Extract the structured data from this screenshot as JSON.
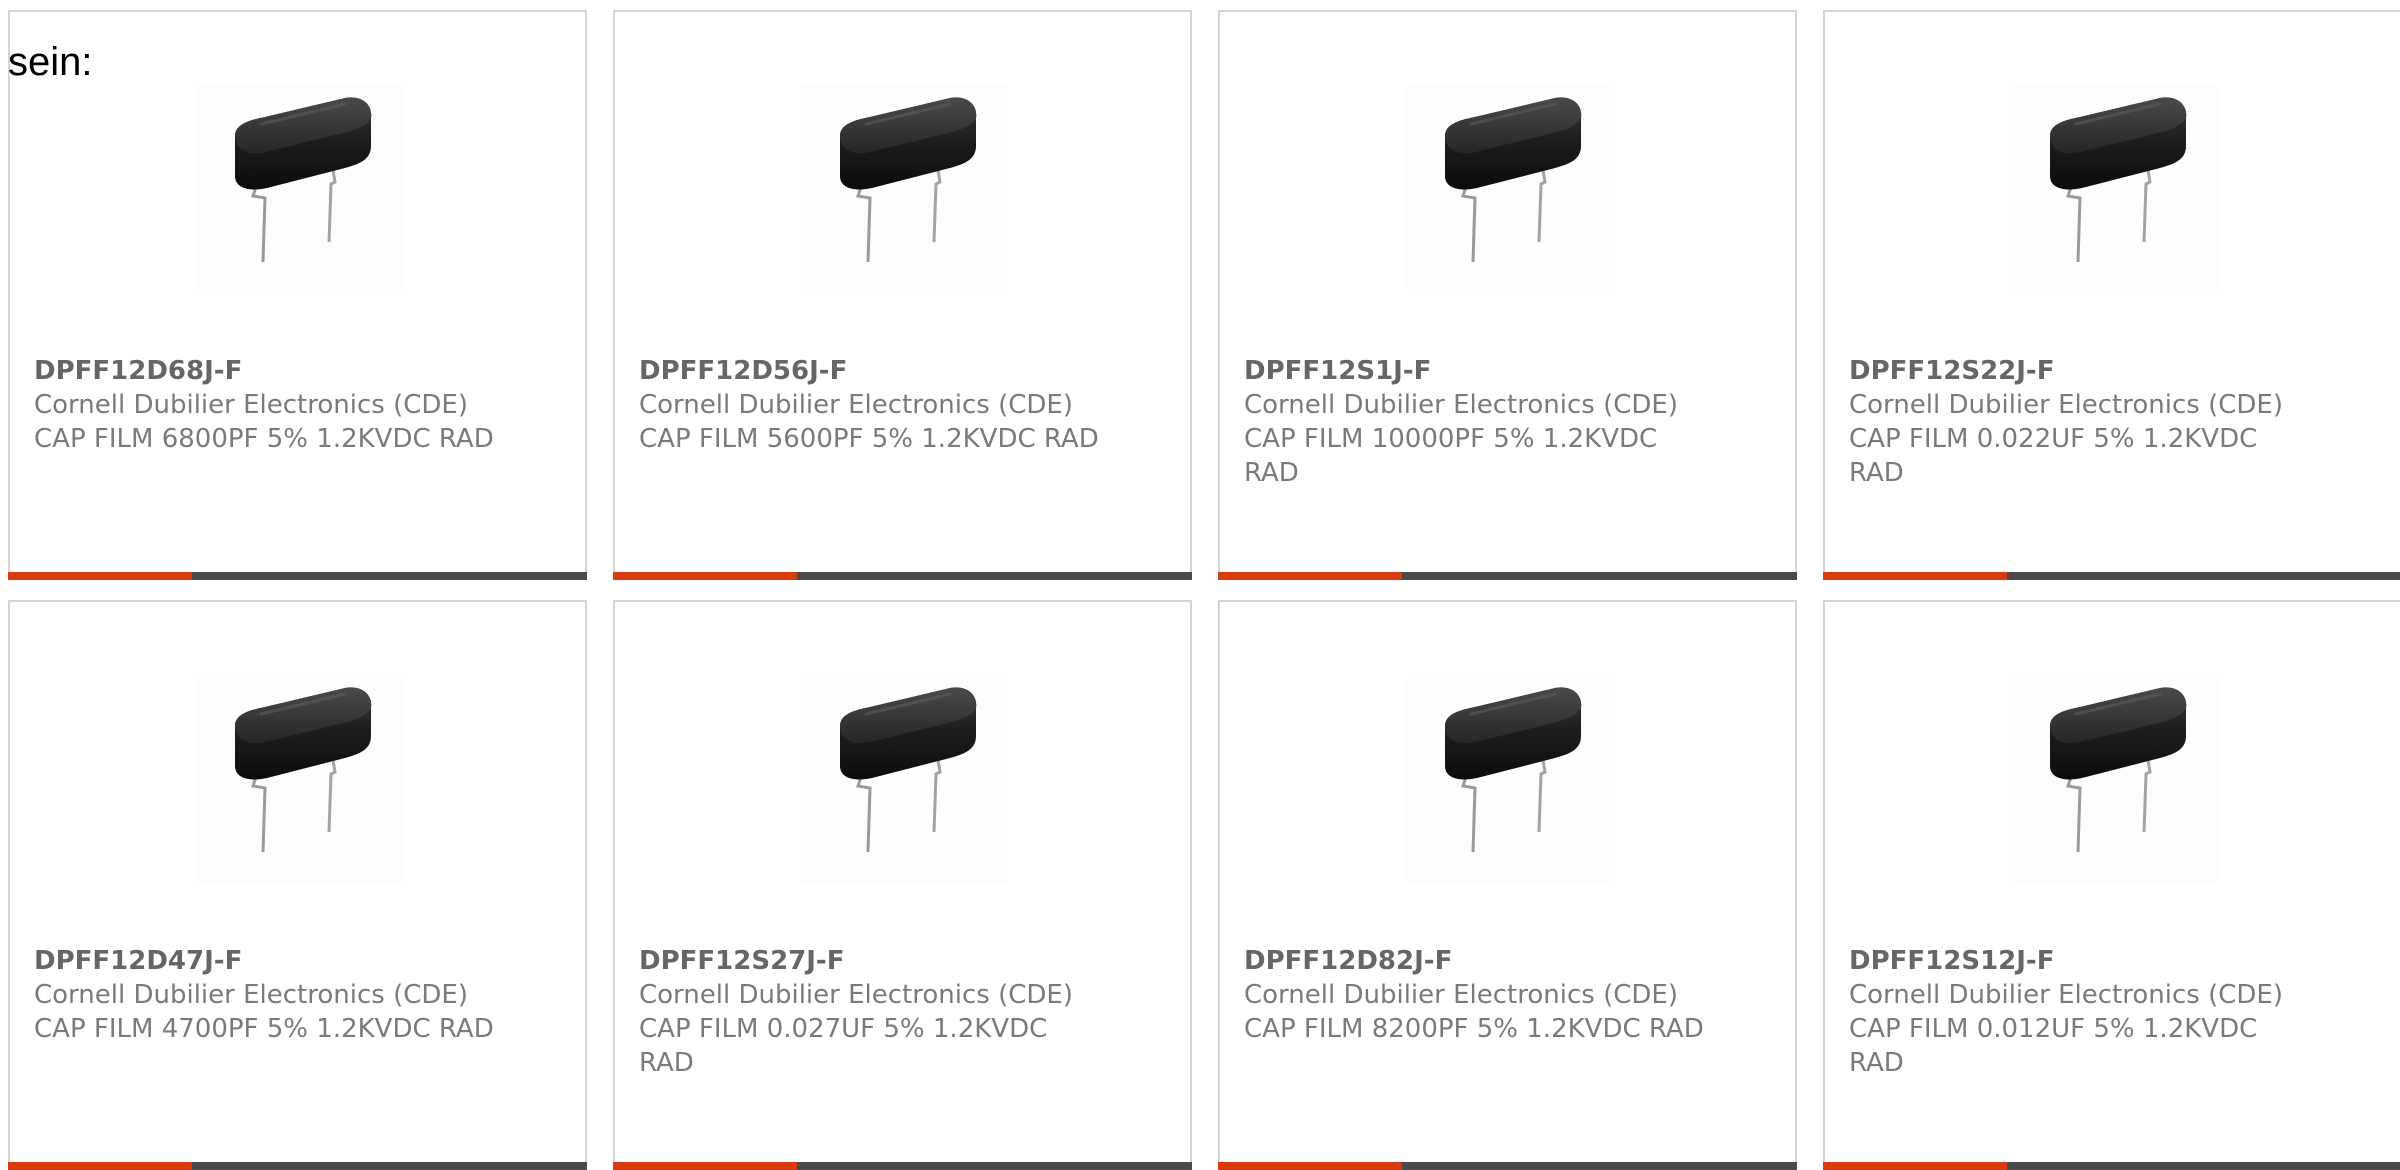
{
  "intro_text": "sein:",
  "colors": {
    "card_border": "#d4d4d4",
    "bar_dark": "#4a4a4a",
    "bar_accent": "#d93a0e",
    "text_gray": "#7a7a7a"
  },
  "products": [
    {
      "part_number": "DPFF12D68J-F",
      "manufacturer": "Cornell Dubilier Electronics (CDE)",
      "description": "CAP FILM 6800PF 5% 1.2KVDC RAD",
      "image": "film-capacitor-photo"
    },
    {
      "part_number": "DPFF12D56J-F",
      "manufacturer": "Cornell Dubilier Electronics (CDE)",
      "description": "CAP FILM 5600PF 5% 1.2KVDC RAD",
      "image": "film-capacitor-photo"
    },
    {
      "part_number": "DPFF12S1J-F",
      "manufacturer": "Cornell Dubilier Electronics (CDE)",
      "description": "CAP FILM 10000PF 5% 1.2KVDC RAD",
      "image": "film-capacitor-photo"
    },
    {
      "part_number": "DPFF12S22J-F",
      "manufacturer": "Cornell Dubilier Electronics (CDE)",
      "description": "CAP FILM 0.022UF 5% 1.2KVDC RAD",
      "image": "film-capacitor-photo"
    },
    {
      "part_number": "DPFF12D47J-F",
      "manufacturer": "Cornell Dubilier Electronics (CDE)",
      "description": "CAP FILM 4700PF 5% 1.2KVDC RAD",
      "image": "film-capacitor-photo"
    },
    {
      "part_number": "DPFF12S27J-F",
      "manufacturer": "Cornell Dubilier Electronics (CDE)",
      "description": "CAP FILM 0.027UF 5% 1.2KVDC RAD",
      "image": "film-capacitor-photo"
    },
    {
      "part_number": "DPFF12D82J-F",
      "manufacturer": "Cornell Dubilier Electronics (CDE)",
      "description": "CAP FILM 8200PF 5% 1.2KVDC RAD",
      "image": "film-capacitor-photo"
    },
    {
      "part_number": "DPFF12S12J-F",
      "manufacturer": "Cornell Dubilier Electronics (CDE)",
      "description": "CAP FILM 0.012UF 5% 1.2KVDC RAD",
      "image": "film-capacitor-photo"
    }
  ]
}
